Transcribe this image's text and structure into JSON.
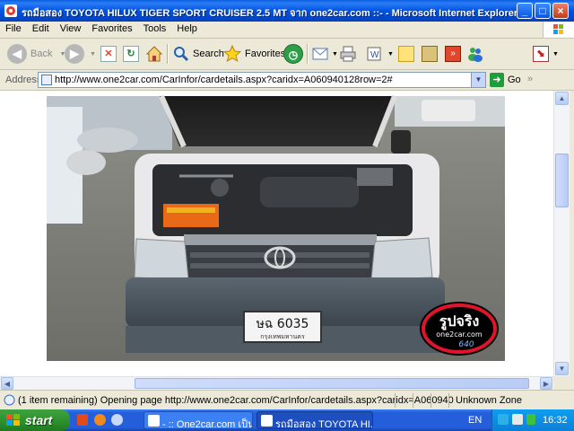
{
  "window": {
    "title": "รถมือสอง TOYOTA HILUX TIGER SPORT CRUISER 2.5 MT จาก one2car.com ::- - Microsoft Internet Explorer",
    "controls": [
      "_",
      "□",
      "×"
    ]
  },
  "menu": {
    "items": [
      "File",
      "Edit",
      "View",
      "Favorites",
      "Tools",
      "Help"
    ]
  },
  "toolbar": {
    "back_label": "Back",
    "search_label": "Search",
    "favorites_label": "Favorites"
  },
  "address": {
    "label": "Address",
    "url": "http://www.one2car.com/CarInfor/cardetails.aspx?caridx=A060940128row=2#",
    "go_label": "Go"
  },
  "content": {
    "photo_subject": "Toyota Hilux pickup with open hood, front view",
    "license_plate": {
      "line1": "ษฉ 6035",
      "line2": "กรุงเทพมหานคร"
    },
    "watermark": {
      "line1": "รูปจริง",
      "line2": "one2car.com",
      "line3": "640"
    }
  },
  "status": {
    "text": "(1 item remaining) Opening page http://www.one2car.com/CarInfor/cardetails.aspx?caridx=A060940",
    "zone": "Unknown Zone"
  },
  "taskbar": {
    "start_label": "start",
    "tasks": [
      {
        "label": "- :: One2car.com เป็น...",
        "active": false
      },
      {
        "label": "รถมือสอง TOYOTA HI...",
        "active": true
      }
    ],
    "tray": {
      "lang": "EN",
      "time": "16:32"
    }
  },
  "colors": {
    "titlebar": "#0054e3",
    "taskbar": "#245edb",
    "start": "#2b8e2b",
    "truck_body": "#e9e9ec",
    "bumper": "#4b5560"
  }
}
